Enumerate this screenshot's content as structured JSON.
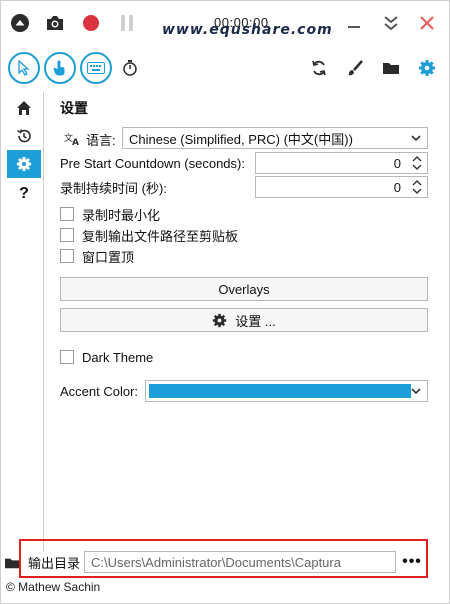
{
  "titlebar": {
    "timer": "00:00:00",
    "watermark": "www.equshare.com",
    "icons": [
      "collapse-up-icon",
      "camera-icon",
      "record-icon",
      "pause-icon",
      "minimize-icon",
      "expand-down-icon",
      "close-icon"
    ]
  },
  "toolbar": {
    "icons": [
      "cursor-icon",
      "click-icon",
      "keyboard-icon",
      "timer-icon",
      "refresh-icon",
      "brush-icon",
      "folder-icon",
      "gear-icon"
    ]
  },
  "sidebar": {
    "items": [
      "home-icon",
      "history-icon",
      "gear-icon",
      "help-icon"
    ],
    "help_text": "?"
  },
  "settings": {
    "title": "设置",
    "language_label": "语言:",
    "language_value": "Chinese (Simplified, PRC) (中文(中国))",
    "countdown_label": "Pre Start Countdown (seconds):",
    "countdown_value": "0",
    "duration_label": "录制持续时间 (秒):",
    "duration_value": "0",
    "checkbox_minimize": "录制时最小化",
    "checkbox_copy_path": "复制输出文件路径至剪贴板",
    "checkbox_topmost": "窗口置顶",
    "overlays_button": "Overlays",
    "settings_button": "设置 ...",
    "dark_theme": "Dark Theme",
    "accent_label": "Accent Color:",
    "accent_color": "#1e9ed8"
  },
  "footer": {
    "output_label": "输出目录",
    "output_path": "C:\\Users\\Administrator\\Documents\\Captura",
    "more_label": "•••",
    "author": "© Mathew Sachin"
  },
  "colors": {
    "accent": "#1e9ed8",
    "record": "#d9333f",
    "close": "#e35b5b",
    "highlight_box": "#e02020"
  }
}
